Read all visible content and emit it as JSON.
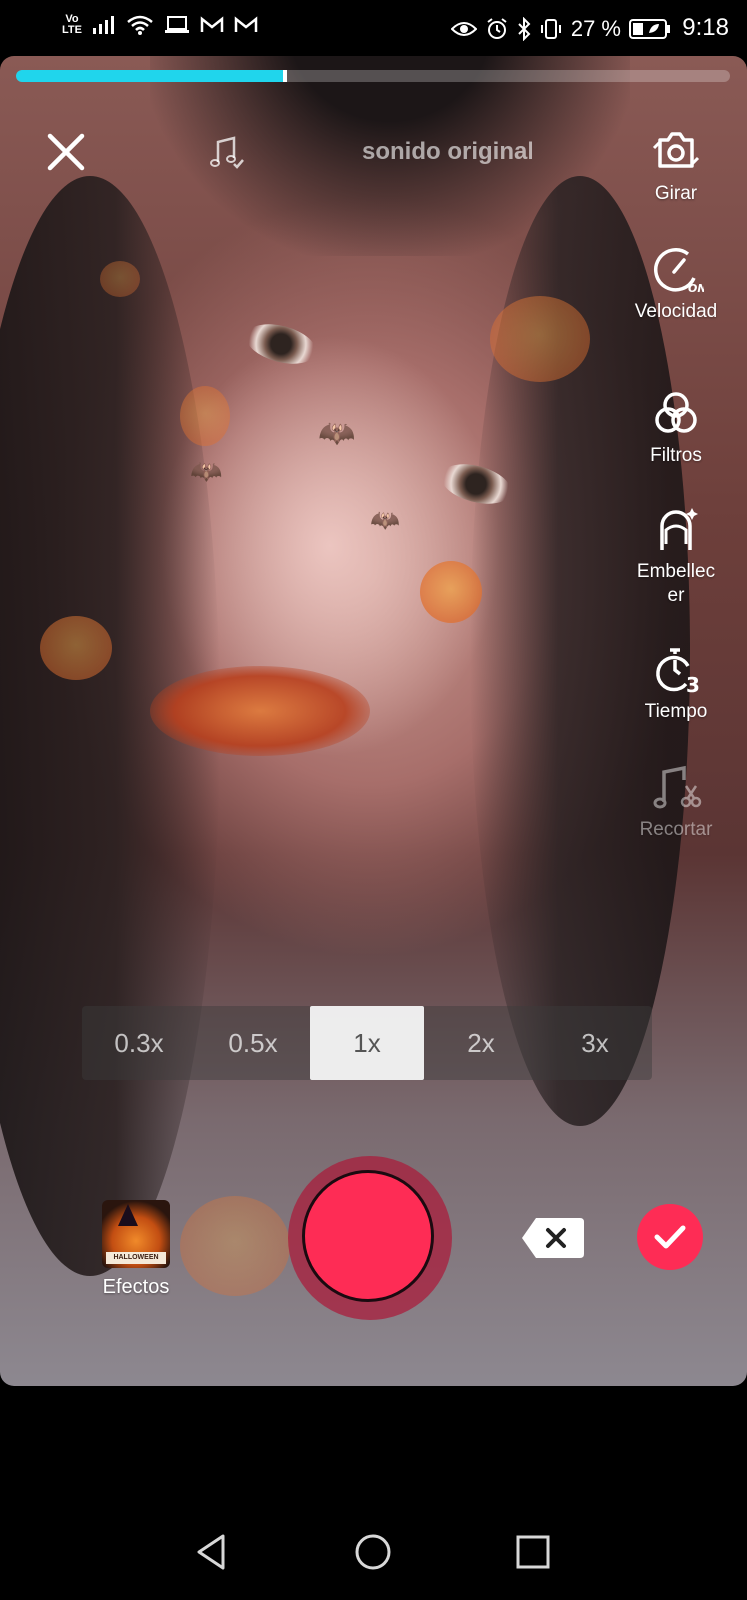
{
  "status_bar": {
    "network_label_top": "Vo",
    "network_label_bottom": "LTE",
    "battery_percent": "27 %",
    "time": "9:18",
    "left_icons": [
      "signal-icon",
      "wifi-icon",
      "laptop-icon",
      "gmail-icon",
      "gmail-icon"
    ],
    "right_icons": [
      "eye-icon",
      "alarm-icon",
      "bluetooth-icon",
      "vibrate-icon",
      "battery-icon"
    ]
  },
  "recording": {
    "progress": 0.38
  },
  "top_bar": {
    "sound_title": "sonido original"
  },
  "side_tools": [
    {
      "label": "Girar",
      "icon": "flip-camera-icon",
      "enabled": true
    },
    {
      "label": "Velocidad",
      "icon": "speed-on-icon",
      "enabled": true
    },
    {
      "label": "Filtros",
      "icon": "filters-icon",
      "enabled": true
    },
    {
      "label": "Embellecer",
      "icon": "beautify-icon",
      "enabled": true
    },
    {
      "label": "Tiempo",
      "icon": "timer-3-icon",
      "enabled": true
    },
    {
      "label": "Recortar",
      "icon": "trim-sound-icon",
      "enabled": false
    }
  ],
  "zoom": {
    "options": [
      "0.3x",
      "0.5x",
      "1x",
      "2x",
      "3x"
    ],
    "selected": "1x"
  },
  "bottom": {
    "effects_label": "Efectos",
    "effects_thumb_text": "HALLOWEEN"
  },
  "colors": {
    "accent": "#fe2c55",
    "progress": "#20d5ec"
  }
}
